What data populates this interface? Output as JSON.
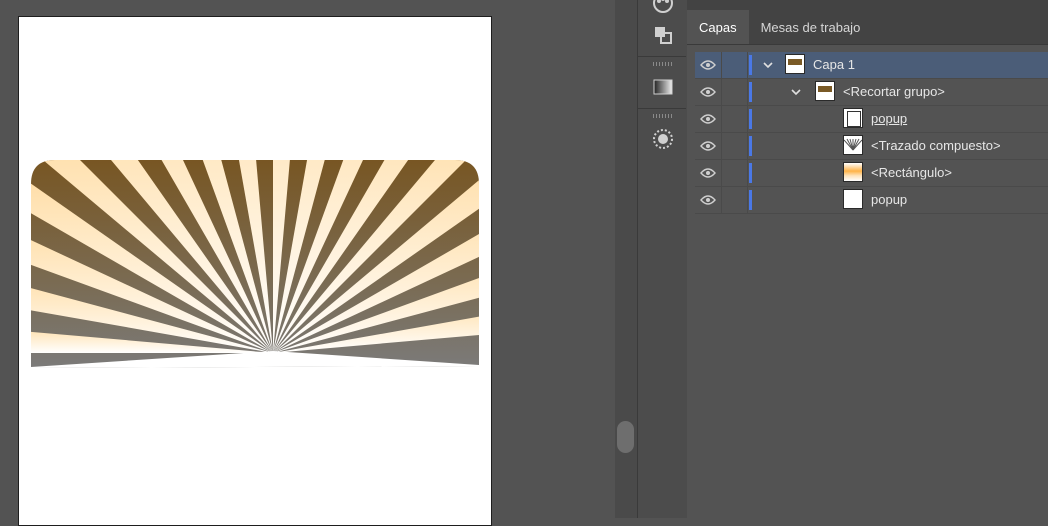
{
  "layers_panel": {
    "tabs": [
      {
        "label": "Capas",
        "active": true
      },
      {
        "label": "Mesas de trabajo",
        "active": false
      }
    ],
    "layers": [
      {
        "name": "Capa 1",
        "level": 0,
        "expanded": true,
        "selected": true,
        "thumb": "brown-rect"
      },
      {
        "name": "<Recortar grupo>",
        "level": 1,
        "expanded": true,
        "selected": false,
        "thumb": "brown-rect"
      },
      {
        "name": "popup",
        "level": 2,
        "selected": false,
        "underline": true,
        "thumb": "white-outline"
      },
      {
        "name": "<Trazado compuesto>",
        "level": 2,
        "selected": false,
        "thumb": "rays"
      },
      {
        "name": "<Rectángulo>",
        "level": 2,
        "selected": false,
        "thumb": "orange-gradient"
      },
      {
        "name": "popup",
        "level": 2,
        "selected": false,
        "thumb": "white"
      }
    ]
  },
  "colors": {
    "selection": "#4b5d78",
    "layer_color": "#4a78e6",
    "ray_top": "#ffae35",
    "ray_bottom": "#ffffff",
    "bg_top": "#7a5a26",
    "bg_bottom": "#7a7a7a"
  },
  "tools": [
    "swatches-icon",
    "pathfinder-icon",
    "gradient-icon",
    "appearance-icon"
  ]
}
